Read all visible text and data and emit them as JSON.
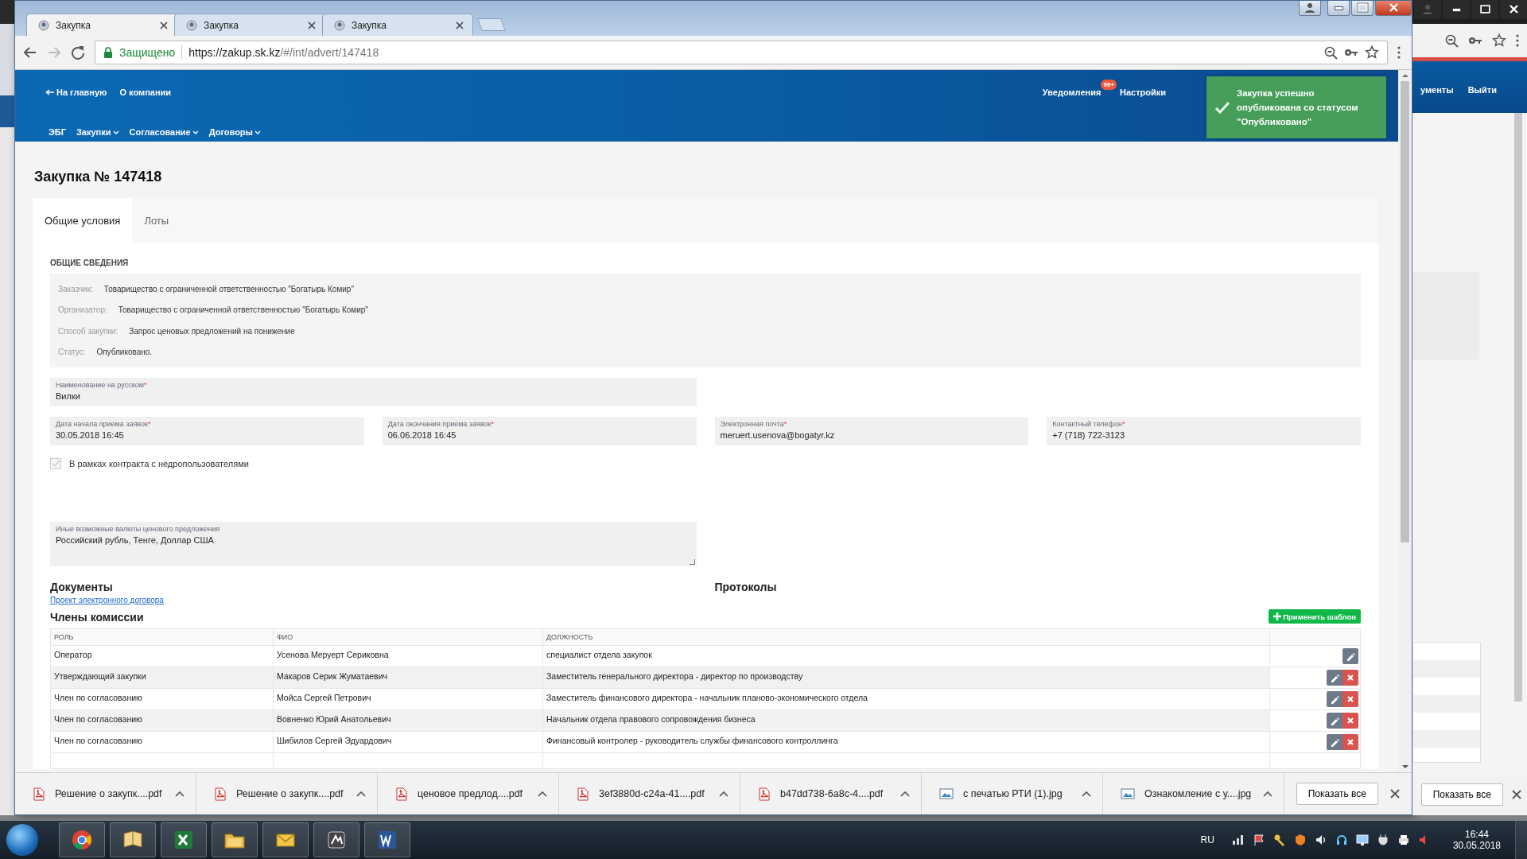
{
  "browser": {
    "tabs": [
      {
        "title": "Закупка",
        "selected": true
      },
      {
        "title": "Закупка",
        "selected": false
      },
      {
        "title": "Закупка",
        "selected": false
      }
    ],
    "address": {
      "secure_label": "Защищено",
      "url_host": "https://zakup.sk.kz",
      "url_path": "/#/int/advert/147418"
    }
  },
  "header": {
    "top_links": [
      {
        "label": "На главную",
        "kind": "back"
      },
      {
        "label": "О компании",
        "kind": "plain"
      }
    ],
    "user_links": [
      {
        "label": "Уведомления",
        "badge": "99+"
      },
      {
        "label": "Настройки"
      }
    ],
    "nav": [
      {
        "label": "ЭБГ",
        "dropdown": false
      },
      {
        "label": "Закупки",
        "dropdown": true
      },
      {
        "label": "Согласование",
        "dropdown": true
      },
      {
        "label": "Договоры",
        "dropdown": true
      }
    ]
  },
  "toast": {
    "message": "Закупка успешно опубликована со статусом \"Опубликовано\""
  },
  "page": {
    "title": "Закупка № 147418",
    "tabs": [
      {
        "label": "Общие условия",
        "selected": true
      },
      {
        "label": "Лоты",
        "selected": false
      }
    ],
    "section_title": "ОБЩИЕ СВЕДЕНИЯ",
    "info": [
      {
        "label": "Заказчик:",
        "value": "Товарищество с ограниченной ответственностью \"Богатырь Комир\""
      },
      {
        "label": "Организатор:",
        "value": "Товарищество с ограниченной ответственностью \"Богатырь Комир\""
      },
      {
        "label": "Способ закупки:",
        "value": "Запрос ценовых предложений на понижение"
      },
      {
        "label": "Статус:",
        "value": "Опубликовано."
      }
    ],
    "fields": [
      {
        "label": "Наименование на русском",
        "mark": "*",
        "value": "Вилки",
        "kind": "wide"
      },
      {
        "label": "Дата начала приема заявок",
        "mark": "*",
        "value": "30.05.2018 16:45",
        "kind": "narrow"
      },
      {
        "label": "Дата окончания приема заявок",
        "mark": "*",
        "value": "06.06.2018 16:45",
        "kind": "narrow"
      },
      {
        "label": "Электронная почта",
        "mark": "*",
        "value": "meruert.usenova@bogatyr.kz",
        "kind": "narrow"
      },
      {
        "label": "Контактный телефон",
        "mark": "*",
        "value": "+7 (718) 722-3123",
        "kind": "narrow"
      }
    ],
    "checkbox": {
      "label": "В рамках контракта с недропользователями",
      "checked": true,
      "disabled": true
    },
    "currencies": {
      "label": "Иные возможные валюты ценового предложения",
      "value": "Российский  рубль, Тенге, Доллар США"
    },
    "documents": {
      "title": "Документы",
      "links": [
        "Проект электронного договора"
      ]
    },
    "protocols": {
      "title": "Протоколы"
    },
    "commission": {
      "title": "Члены комиссии",
      "apply_button": "Применить шаблон",
      "columns": [
        "РОЛЬ",
        "ФИО",
        "ДОЛЖНОСТЬ"
      ],
      "rows": [
        {
          "role": "Оператор",
          "name": "Усенова Меруерт Сериковна",
          "position": "специалист отдела закупок",
          "deletable": false
        },
        {
          "role": "Утверждающий закупки",
          "name": "Макаров Серик Жуматаевич",
          "position": "Заместитель генерального директора - директор по производству",
          "deletable": true
        },
        {
          "role": "Член по согласованию",
          "name": "Мойса Сергей Петрович",
          "position": "Заместитель финансового директора - начальник планово-экономического отдела",
          "deletable": true
        },
        {
          "role": "Член по согласованию",
          "name": "Вовненко Юрий Анатольевич",
          "position": "Начальник отдела правового сопровождения бизнеса",
          "deletable": true
        },
        {
          "role": "Член по согласованию",
          "name": "Шибилов Сергей Эдуардович",
          "position": "Финансовый контролер - руководитель службы финансового контроллинга",
          "deletable": true
        }
      ]
    }
  },
  "downloads": {
    "items": [
      {
        "name": "Решение о закупк....pdf",
        "kind": "pdf"
      },
      {
        "name": "Решение о закупк....pdf",
        "kind": "pdf"
      },
      {
        "name": "ценовое предлод....pdf",
        "kind": "pdf"
      },
      {
        "name": "3ef3880d-c24a-41....pdf",
        "kind": "pdf"
      },
      {
        "name": "b47dd738-6a8c-4....pdf",
        "kind": "pdf"
      },
      {
        "name": "с печатью РТИ (1).jpg",
        "kind": "image"
      },
      {
        "name": "Ознакомление с у....jpg",
        "kind": "image"
      }
    ],
    "show_all": "Показать все"
  },
  "background_window": {
    "links": [
      "ументы",
      "Выйти"
    ],
    "show_all": "Показать все"
  },
  "taskbar": {
    "apps": [
      {
        "kind": "chrome"
      },
      {
        "kind": "notebook"
      },
      {
        "kind": "excel"
      },
      {
        "kind": "folder"
      },
      {
        "kind": "mail"
      },
      {
        "kind": "tool"
      },
      {
        "kind": "word"
      }
    ],
    "language": "RU",
    "time": "16:44",
    "date": "30.05.2018"
  }
}
